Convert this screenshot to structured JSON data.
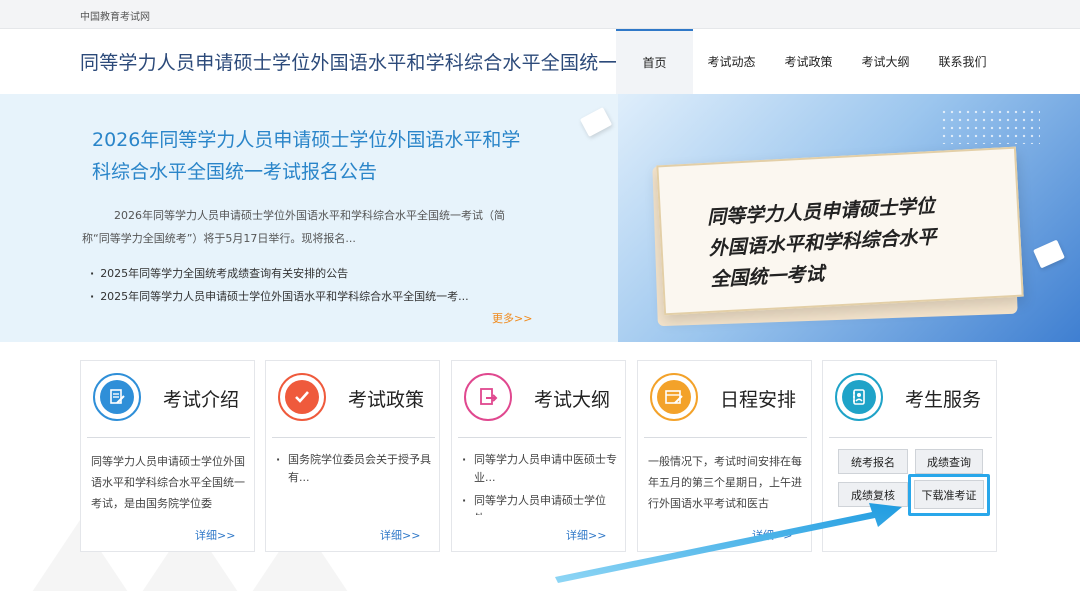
{
  "topbar": {
    "site_name": "中国教育考试网"
  },
  "header": {
    "title": "同等学力人员申请硕士学位外国语水平和学科综合水平全国统一考试",
    "nav": [
      {
        "label": "首页",
        "active": true
      },
      {
        "label": "考试动态"
      },
      {
        "label": "考试政策"
      },
      {
        "label": "考试大纲"
      },
      {
        "label": "联系我们"
      }
    ]
  },
  "banner": {
    "title": "2026年同等学力人员申请硕士学位外国语水平和学科综合水平全国统一考试报名公告",
    "desc": "2026年同等学力人员申请硕士学位外国语水平和学科综合水平全国统一考试（简称“同等学力全国统考”）将于5月17日举行。现将报名...",
    "list": [
      "2025年同等学力全国统考成绩查询有关安排的公告",
      "2025年同等学力人员申请硕士学位外国语水平和学科综合水平全国统一考..."
    ],
    "more": "更多>>",
    "card_lines": [
      "同等学力人员申请硕士学位",
      "外国语水平和学科综合水平",
      "全国统一考试"
    ]
  },
  "sections": [
    {
      "name": "考试介绍",
      "icon": "document-edit-icon",
      "color": "#2f8fd8",
      "text": "同等学力人员申请硕士学位外国语水平和学科综合水平全国统一考试，是由国务院学位委",
      "detail": "详细>>"
    },
    {
      "name": "考试政策",
      "icon": "checkmark-icon",
      "color": "#ef5a3c",
      "items": [
        "国务院学位委员会关于授予具有..."
      ],
      "detail": "详细>>"
    },
    {
      "name": "考试大纲",
      "icon": "export-document-icon",
      "color": "#e0488f",
      "items": [
        "同等学力人员申请中医硕士专业...",
        "同等学力人员申请硕士学位外..."
      ],
      "detail": "详细>>"
    },
    {
      "name": "日程安排",
      "icon": "calendar-edit-icon",
      "color": "#f3a22a",
      "text": "一般情况下，考试时间安排在每年五月的第三个星期日，上午进行外国语水平考试和医古",
      "detail": "详细>>"
    },
    {
      "name": "考生服务",
      "icon": "address-book-icon",
      "color": "#1fa3c8",
      "buttons": [
        "统考报名",
        "成绩查询",
        "成绩复核",
        "下载准考证"
      ]
    }
  ],
  "colors": {
    "accent": "#2f78c8",
    "highlight": "#29a7ea",
    "more": "#f08a1c"
  }
}
